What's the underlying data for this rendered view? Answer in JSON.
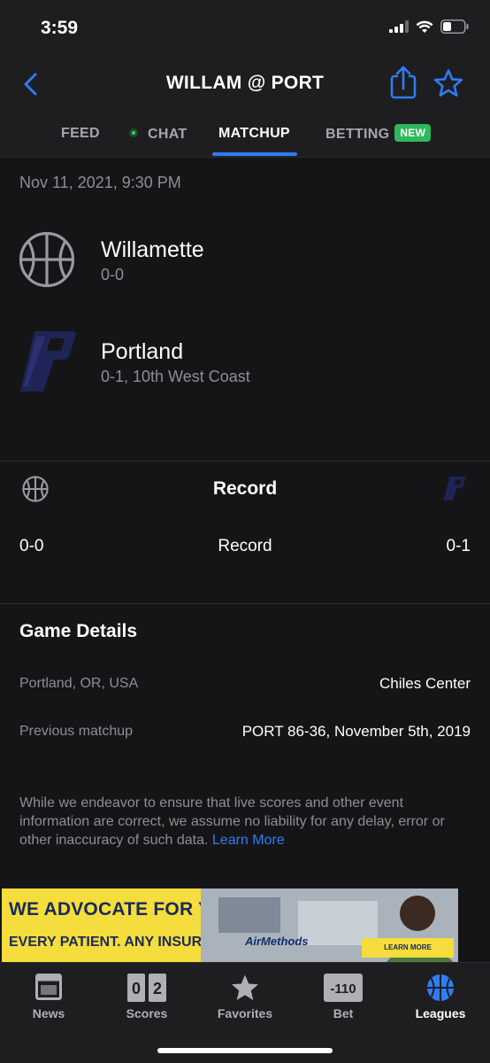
{
  "status": {
    "time": "3:59"
  },
  "header": {
    "title": "WILLAM @ PORT"
  },
  "tabs": [
    {
      "label": "FEED"
    },
    {
      "label": "CHAT"
    },
    {
      "label": "MATCHUP"
    },
    {
      "label": "BETTING",
      "badge": "NEW"
    }
  ],
  "game": {
    "date": "Nov 11, 2021, 9:30 PM"
  },
  "teams": {
    "away": {
      "name": "Willamette",
      "record": "0-0"
    },
    "home": {
      "name": "Portland",
      "record": "0-1, 10th West Coast",
      "logo_color": "#1f2456"
    }
  },
  "record_section": {
    "title": "Record",
    "away_value": "0-0",
    "label": "Record",
    "home_value": "0-1"
  },
  "details": {
    "title": "Game Details",
    "rows": [
      {
        "label": "Portland, OR, USA",
        "value": "Chiles Center"
      },
      {
        "label": "Previous matchup",
        "value": "PORT 86-36, November 5th, 2019"
      }
    ]
  },
  "disclaimer": {
    "text": "While we endeavor to ensure that live scores and other event information are correct, we assume no liability for any delay, error or other inaccuracy of such data.",
    "link": "Learn More"
  },
  "ad": {
    "line1": "WE ADVOCATE FOR YOU.",
    "line2": "EVERY PATIENT. ANY INSURANCE.",
    "brand": "AirMethods",
    "cta": "LEARN MORE"
  },
  "bottom_nav": {
    "items": [
      {
        "label": "News",
        "icon": "news-icon"
      },
      {
        "label": "Scores",
        "icon": "scores-icon",
        "digits": [
          "0",
          "2"
        ]
      },
      {
        "label": "Favorites",
        "icon": "star-icon"
      },
      {
        "label": "Bet",
        "icon": "bet-icon",
        "badge": "-110"
      },
      {
        "label": "Leagues",
        "icon": "basketball-icon"
      }
    ]
  },
  "colors": {
    "accent": "#2f7cf6",
    "new_badge": "#2eb85c",
    "ad_yellow": "#f4dd3c"
  }
}
